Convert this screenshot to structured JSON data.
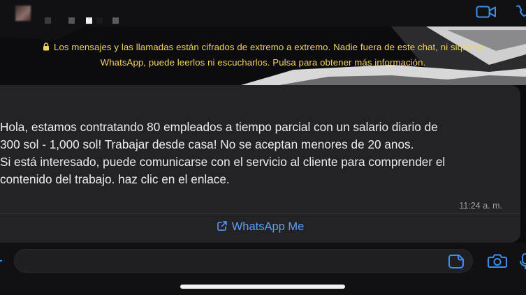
{
  "header": {
    "contact_name": "",
    "accent_color": "#3d8ef0",
    "icons": [
      "video-call-icon",
      "voice-call-icon"
    ]
  },
  "encryption_notice": {
    "line1": "Los mensajes y las llamadas están cifrados de extremo a extremo. Nadie fuera de este chat, ni siquiera",
    "line2": "WhatsApp, puede leerlos ni escucharlos. Pulsa para obtener más información.",
    "color": "#f2d45c",
    "icon": "lock-icon"
  },
  "message": {
    "lines": [
      "Hola, estamos contratando 80 empleados a tiempo parcial con un salario diario de",
      "300 sol - 1,000 sol!  Trabajar desde casa! No se aceptan menores de 20 anos.",
      "Si está interesado, puede comunicarse con el servicio al cliente para comprender el",
      "contenido del trabajo. haz clic en el enlace."
    ],
    "time": "11:24 a. m.",
    "link_label": "WhatsApp Me",
    "link_icon": "external-link-icon",
    "link_color": "#5d9ff5"
  },
  "composer": {
    "input_value": "",
    "icons": [
      "plus-icon",
      "sticker-icon",
      "camera-icon",
      "microphone-icon"
    ]
  }
}
